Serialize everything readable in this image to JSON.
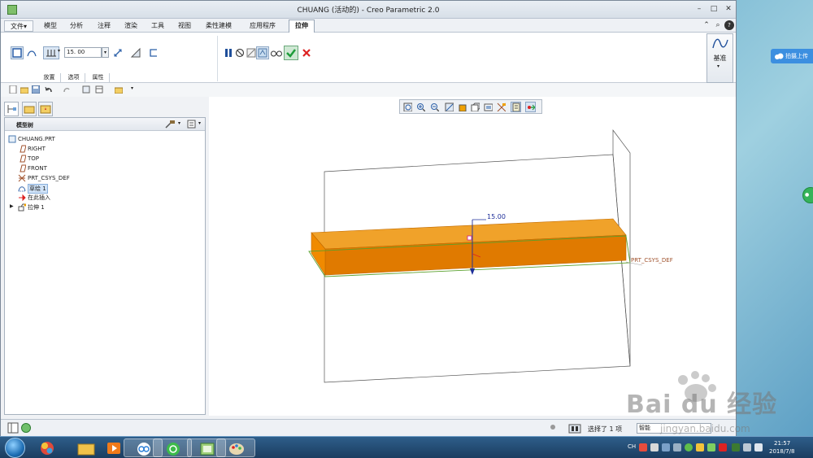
{
  "window": {
    "title": "CHUANG (活动的) - Creo Parametric 2.0",
    "controls": [
      "–",
      "□",
      "✕"
    ]
  },
  "menu": {
    "file": "文件▾",
    "tabs": [
      "模型",
      "分析",
      "注释",
      "渲染",
      "工具",
      "视图",
      "柔性建模",
      "应用程序"
    ],
    "active_tab": "拉伸"
  },
  "ribbon": {
    "depth_value": "15. 00",
    "subtabs": [
      "放置",
      "选项",
      "属性"
    ],
    "datum_label": "基准"
  },
  "model_tree": {
    "header": "模型树",
    "items": [
      {
        "label": "CHUANG.PRT",
        "icon": "part-icon"
      },
      {
        "label": "RIGHT",
        "icon": "datum-plane-icon"
      },
      {
        "label": "TOP",
        "icon": "datum-plane-icon"
      },
      {
        "label": "FRONT",
        "icon": "datum-plane-icon"
      },
      {
        "label": "PRT_CSYS_DEF",
        "icon": "csys-icon"
      },
      {
        "label": "草绘 1",
        "icon": "sketch-icon"
      },
      {
        "label": "在此插入",
        "icon": "insert-here-icon"
      },
      {
        "label": "拉伸 1",
        "icon": "extrude-icon"
      }
    ]
  },
  "graphics": {
    "dimension": "15.00",
    "csys_label": "PRT_CSYS_DEF",
    "part_color": "#f08a00"
  },
  "status": {
    "selected": "选择了 1 项",
    "filter": "智能"
  },
  "side_widget": {
    "label": "拍摄上传"
  },
  "taskbar": {
    "ime": "CH",
    "time": "21:57",
    "date": "2018/7/8"
  },
  "watermark": {
    "text": "Bai du 经验",
    "sub": "jingyan.baidu.com"
  }
}
